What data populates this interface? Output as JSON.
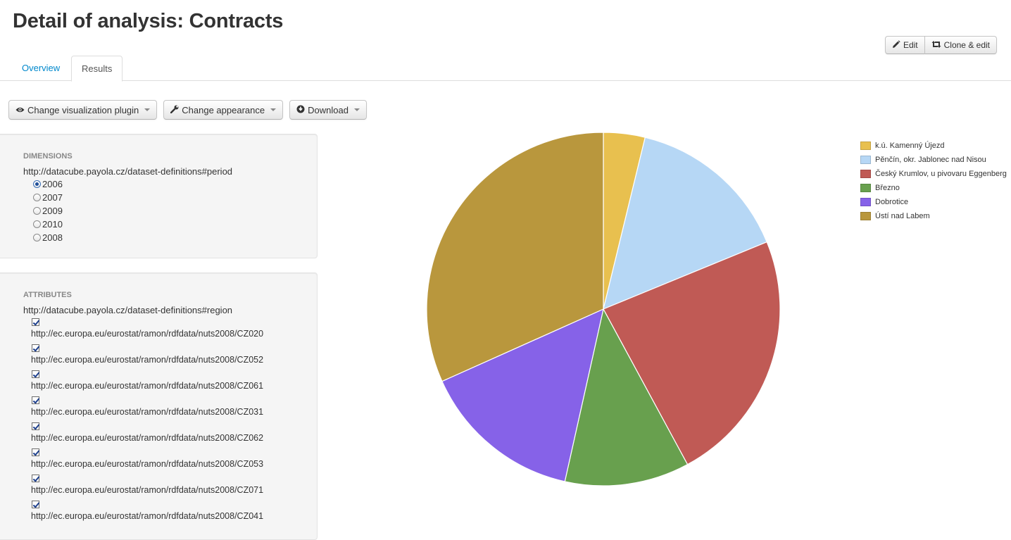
{
  "page": {
    "title": "Detail of analysis: Contracts"
  },
  "header_buttons": {
    "edit": "Edit",
    "clone_edit": "Clone & edit"
  },
  "tabs": [
    {
      "label": "Overview"
    },
    {
      "label": "Results"
    }
  ],
  "active_tab": "Results",
  "toolbar": {
    "change_plugin": "Change visualization plugin",
    "change_appearance": "Change appearance",
    "download": "Download"
  },
  "dimensions": {
    "heading": "DIMENSIONS",
    "uri": "http://datacube.payola.cz/dataset-definitions#period",
    "options": [
      "2006",
      "2007",
      "2009",
      "2010",
      "2008"
    ],
    "selected": "2006"
  },
  "attributes": {
    "heading": "ATTRIBUTES",
    "uri": "http://datacube.payola.cz/dataset-definitions#region",
    "items": [
      "http://ec.europa.eu/eurostat/ramon/rdfdata/nuts2008/CZ020",
      "http://ec.europa.eu/eurostat/ramon/rdfdata/nuts2008/CZ052",
      "http://ec.europa.eu/eurostat/ramon/rdfdata/nuts2008/CZ061",
      "http://ec.europa.eu/eurostat/ramon/rdfdata/nuts2008/CZ031",
      "http://ec.europa.eu/eurostat/ramon/rdfdata/nuts2008/CZ062",
      "http://ec.europa.eu/eurostat/ramon/rdfdata/nuts2008/CZ053",
      "http://ec.europa.eu/eurostat/ramon/rdfdata/nuts2008/CZ071",
      "http://ec.europa.eu/eurostat/ramon/rdfdata/nuts2008/CZ041"
    ],
    "checked": true
  },
  "icons": {
    "edit": "pencil-icon",
    "clone": "retweet-icon",
    "plugin": "eye-icon",
    "appearance": "wrench-icon",
    "download": "download-circle-icon"
  },
  "chart_data": {
    "type": "pie",
    "title": "",
    "labels": [
      "k.ú. Kamenný Újezd",
      "Pěnčín, okr. Jablonec nad Nisou",
      "Český Krumlov, u pivovaru Eggenberg",
      "Březno",
      "Dobrotice",
      "Ústí nad Labem"
    ],
    "values": [
      3.8,
      15.0,
      23.3,
      11.4,
      14.8,
      31.7
    ],
    "colors": [
      "#e8c04f",
      "#b6d7f5",
      "#c05a55",
      "#68a04e",
      "#8662e8",
      "#b9973d"
    ],
    "legend_position": "right"
  }
}
